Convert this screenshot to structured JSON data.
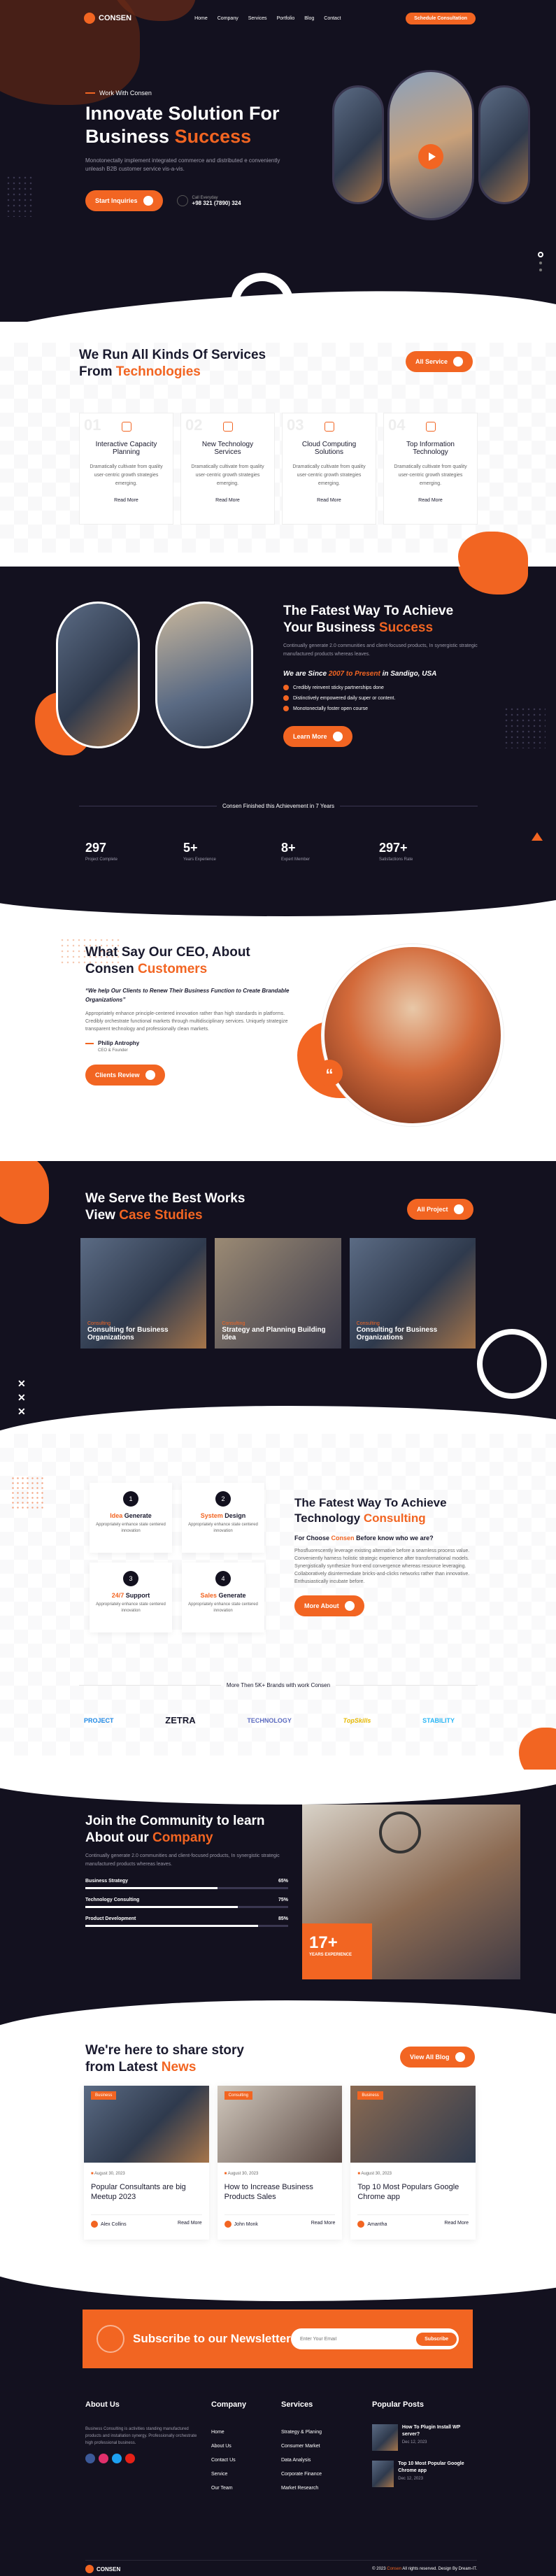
{
  "nav": {
    "logo": "CONSEN",
    "items": [
      "Home",
      "Company",
      "Services",
      "Portfolio",
      "Blog",
      "Contact"
    ],
    "cta": "Schedule Consultation"
  },
  "hero": {
    "eyebrow": "Work With Consen",
    "title_line1": "Innovate Solution For",
    "title_line2_a": "Business",
    "title_line2_b": "Success",
    "desc": "Monotonectally implement integrated commerce and distributed e conveniently unleash B2B customer service vis-a-vis.",
    "cta": "Start Inquiries",
    "call_label": "Call Everyday",
    "phone": "+98 321 (7890) 324"
  },
  "services": {
    "title_a": "We Run All Kinds Of Services",
    "title_b": "From",
    "title_c": "Technologies",
    "all_btn": "All Service",
    "cards": [
      {
        "num": "01",
        "title": "Interactive Capacity Planning",
        "desc": "Dramatically cultivate from quality user-centric growth strategies emerging.",
        "link": "Read More"
      },
      {
        "num": "02",
        "title": "New Technology Services",
        "desc": "Dramatically cultivate from quality user-centric growth strategies emerging.",
        "link": "Read More"
      },
      {
        "num": "03",
        "title": "Cloud Computing Solutions",
        "desc": "Dramatically cultivate from quality user-centric growth strategies emerging.",
        "link": "Read More"
      },
      {
        "num": "04",
        "title": "Top Information Technology",
        "desc": "Dramatically cultivate from quality user-centric growth strategies emerging.",
        "link": "Read More"
      }
    ]
  },
  "about": {
    "title_line1": "The Fatest Way To Achieve",
    "title_line2_a": "Your Business",
    "title_line2_b": "Success",
    "desc": "Continually generate 2.0 communities and client-focused products, In synergistic strategic manufactured products whereas leaves.",
    "since_a": "We are Since",
    "since_b": "2007 to Present",
    "since_c": "in Sandigo, USA",
    "checks": [
      "Credibly reinvent sticky partnerships done",
      "Distinctively empowered daily super or content.",
      "Monotonectally foster open course"
    ],
    "cta": "Learn More"
  },
  "stats": {
    "heading": "Consen Finished this Achievement in 7 Years",
    "items": [
      {
        "value": "297",
        "label": "Project Complete"
      },
      {
        "value": "5+",
        "label": "Years Experience"
      },
      {
        "value": "8+",
        "label": "Expert Member"
      },
      {
        "value": "297+",
        "label": "Satisfactions Rate"
      }
    ]
  },
  "ceo": {
    "title_a": "What Say Our CEO, About",
    "title_b": "Consen",
    "title_c": "Customers",
    "quote": "“We help Our Clients to Renew Their Business Function to Create Brandable Organizations”",
    "desc": "Appropriately enhance principle-centered innovation rather than high standards in platforms. Credibly orchestrate functional markets through multidisciplinary services. Uniquely strategize transparent technology and professionally clean markets.",
    "name": "Philip Antrophy",
    "role": "CEO & Founder",
    "cta": "Clients Review"
  },
  "cases": {
    "title_line1": "We Serve the Best Works",
    "title_line2_a": "View",
    "title_line2_b": "Case Studies",
    "all_btn": "All Project",
    "items": [
      {
        "tag": "Consulting",
        "title": "Consulting for Business Organizations"
      },
      {
        "tag": "Consulting",
        "title": "Strategy and Planning Building Idea"
      },
      {
        "tag": "Consulting",
        "title": "Consulting for Business Organizations"
      }
    ]
  },
  "features": {
    "cards": [
      {
        "num": "1",
        "t1": "Idea",
        "t2": "Generate",
        "desc": "Appropriately enhance state centered innovation"
      },
      {
        "num": "2",
        "t1": "System",
        "t2": "Design",
        "desc": "Appropriately enhance state centered innovation"
      },
      {
        "num": "3",
        "t1": "24/7",
        "t2": "Support",
        "desc": "Appropriately enhance state centered innovation"
      },
      {
        "num": "4",
        "t1": "Sales",
        "t2": "Generate",
        "desc": "Appropriately enhance state centered innovation"
      }
    ],
    "title_line1": "The Fatest Way To Achieve",
    "title_line2_a": "Technology",
    "title_line2_b": "Consulting",
    "sub_a": "For Choose",
    "sub_b": "Consen",
    "sub_c": "Before know who we are?",
    "desc": "Phosfluorescently leverage existing alternative before a seamless process value. Conveniently harness holistic strategic experience after transformational models. Synergistically synthesize front-end convergence whereas resource leveraging. Collaboratively disintermediate bricks-and-clicks networks rather than innovative. Enthusiastically incubate before.",
    "cta": "More About"
  },
  "brands": {
    "heading": "More Then 5K+ Brands with work Consen",
    "items": [
      "PROJECT",
      "ZETRA",
      "TECHNOLOGY",
      "TopSkills",
      "STABILITY"
    ]
  },
  "community": {
    "title_line1": "Join the Community to learn",
    "title_line2_a": "About our",
    "title_line2_b": "Company",
    "desc": "Continually generate 2.0 communities and client-focused products, In synergistic strategic manufactured products whereas leaves.",
    "bars": [
      {
        "label": "Business Strategy",
        "value": 65,
        "text": "65%"
      },
      {
        "label": "Technology Consulting",
        "value": 75,
        "text": "75%"
      },
      {
        "label": "Product Development",
        "value": 85,
        "text": "85%"
      }
    ],
    "years": "17+",
    "years_label": "YEARS EXPERIENCE"
  },
  "blog": {
    "title_line1": "We're here to share story",
    "title_line2_a": "from Latest",
    "title_line2_b": "News",
    "all_btn": "View All Blog",
    "posts": [
      {
        "tag": "Business",
        "date": "August 30, 2023",
        "title": "Popular Consultants are big Meetup 2023",
        "author": "Alex Collins",
        "link": "Read More"
      },
      {
        "tag": "Consulting",
        "date": "August 30, 2023",
        "title": "How to Increase Business Products Sales",
        "author": "John Monk",
        "link": "Read More"
      },
      {
        "tag": "Business",
        "date": "August 30, 2023",
        "title": "Top 10 Most Populars Google Chrome app",
        "author": "Amantha",
        "link": "Read More"
      }
    ]
  },
  "newsletter": {
    "title": "Subscribe to our Newsletter",
    "placeholder": "Enter Your Email",
    "button": "Subscribe"
  },
  "footer": {
    "about_title": "About Us",
    "about_desc": "Business Consulting is activities standing manufactured products and installation synergy. Professionally orchestrate high professional business.",
    "company_title": "Company",
    "company_links": [
      "Home",
      "About Us",
      "Contact Us",
      "Service",
      "Our Team"
    ],
    "services_title": "Services",
    "services_links": [
      "Strategy & Planing",
      "Consumer Market",
      "Data Analysis",
      "Corporate Finance",
      "Market Research"
    ],
    "posts_title": "Popular Posts",
    "posts": [
      {
        "title": "How To Plugin Install WP server?",
        "date": "Dec 12, 2023"
      },
      {
        "title": "Top 10 Most Popular Google Chrome app",
        "date": "Dec 12, 2023"
      }
    ],
    "logo": "CONSEN",
    "copyright_a": "© 2023",
    "copyright_b": "Consen",
    "copyright_c": "All rights reserved. Design By Dream-IT."
  },
  "colors": {
    "accent": "#f26522",
    "dark": "#13111f"
  }
}
